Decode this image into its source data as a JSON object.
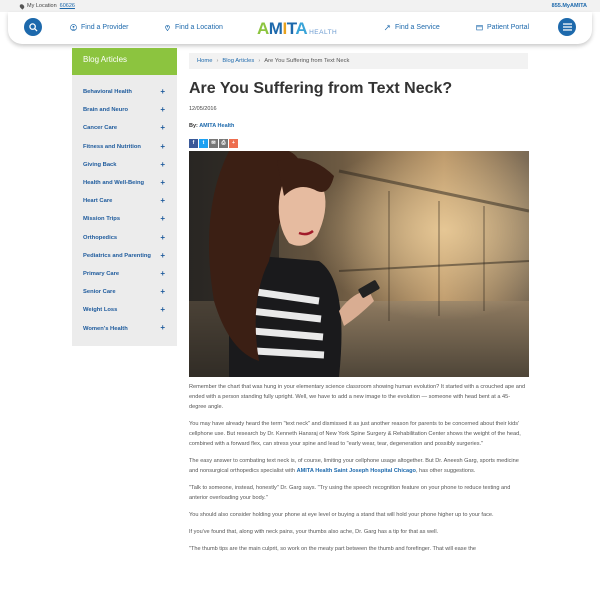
{
  "utility": {
    "location_label": "My Location",
    "zip": "60626",
    "phone": "855.MyAMITA"
  },
  "nav": {
    "find_provider": "Find a Provider",
    "find_location": "Find a Location",
    "find_service": "Find a Service",
    "patient_portal": "Patient Portal"
  },
  "logo": {
    "brand": "AMITA",
    "sub": "HEALTH"
  },
  "colors": {
    "brand_blue": "#1d69ac",
    "sidebar_green": "#8cc43f"
  },
  "sidebar": {
    "heading": "Blog Articles",
    "items": [
      {
        "label": "Behavioral Health"
      },
      {
        "label": "Brain and Neuro"
      },
      {
        "label": "Cancer Care"
      },
      {
        "label": "Fitness and Nutrition"
      },
      {
        "label": "Giving Back"
      },
      {
        "label": "Health and Well-Being"
      },
      {
        "label": "Heart Care"
      },
      {
        "label": "Mission Trips"
      },
      {
        "label": "Orthopedics"
      },
      {
        "label": "Pediatrics and Parenting"
      },
      {
        "label": "Primary Care"
      },
      {
        "label": "Senior Care"
      },
      {
        "label": "Weight Loss"
      },
      {
        "label": "Women's Health"
      }
    ]
  },
  "breadcrumb": {
    "home": "Home",
    "section": "Blog Articles",
    "current": "Are You Suffering from Text Neck"
  },
  "article": {
    "title": "Are You Suffering from Text Neck?",
    "date": "12/05/2016",
    "by_label": "By:",
    "author": "AMITA Health",
    "p1": "Remember the chart that was hung in your elementary science classroom showing human evolution? It started with a crouched ape and ended with a person standing fully upright. Well, we have to add a new image to the evolution — someone with head bent at a 45-degree angle.",
    "p2": "You may have already heard the term \"text neck\" and dismissed it as just another reason for parents to be concerned about their kids' cellphone use. But research by Dr. Kenneth Hansraj of New York Spine Surgery & Rehabilitation Center shows the weight of the head, combined with a forward flex, can stress your spine and lead to \"early wear, tear, degeneration and possibly surgeries.\"",
    "p3_before": "The easy answer to combating text neck is, of course, limiting your cellphone usage altogether. But Dr. Aneesh Garg, sports medicine and nonsurgical orthopedics specialist with ",
    "p3_link": "AMITA Health Saint Joseph Hospital Chicago",
    "p3_after": ", has other suggestions.",
    "p4": "\"Talk to someone, instead, honestly\" Dr. Garg says. \"Try using the speech recognition feature on your phone to reduce texting and anterior overloading your body.\"",
    "p5": "You should also consider holding your phone at eye level or buying a stand that will hold your phone higher up to your face.",
    "p6": "If you've found that, along with neck pains, your thumbs also ache, Dr. Garg has a tip for that as well.",
    "p7": "\"The thumb tips are the main culprit, so work on the meaty part between the thumb and forefinger. That will ease the"
  }
}
